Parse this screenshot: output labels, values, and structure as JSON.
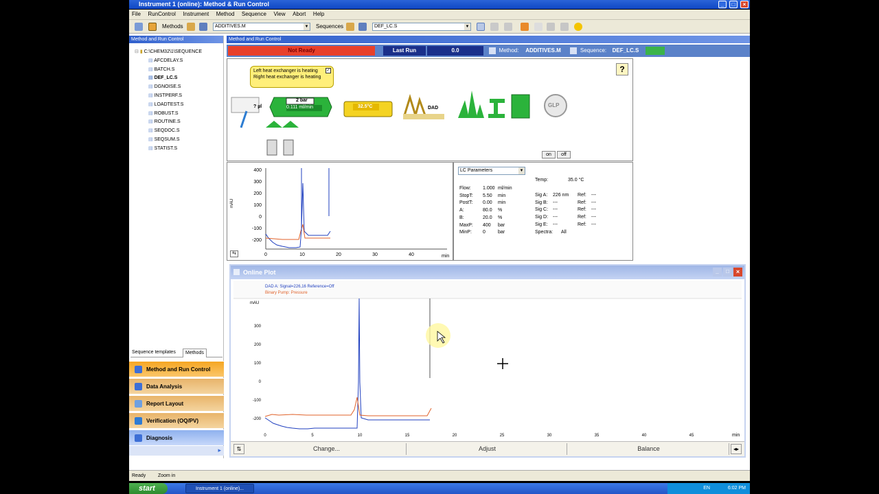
{
  "window": {
    "title": "Instrument 1 (online): Method & Run Control"
  },
  "menu": [
    "File",
    "RunControl",
    "Instrument",
    "Method",
    "Sequence",
    "View",
    "Abort",
    "Help"
  ],
  "toolbar": {
    "methods_label": "Methods",
    "method_value": "ADDITIVES.M",
    "sequences_label": "Sequences",
    "sequence_value": "DEF_LC.S"
  },
  "left_panel": {
    "title": "Method and Run Control",
    "root": "C:\\CHEM32\\1\\SEQUENCE",
    "files": [
      "AFCDELAY.S",
      "BATCH.S",
      "DEF_LC.S",
      "DGNOISE.S",
      "INSTPERF.S",
      "LOADTEST.S",
      "ROBUST.S",
      "ROUTINE.S",
      "SEQDOC.S",
      "SEQSUM.S",
      "STATIST.S"
    ],
    "tabs": [
      "Sequence templates",
      "Methods"
    ],
    "nav": [
      "Method and Run Control",
      "Data Analysis",
      "Report Layout",
      "Verification (OQ/PV)",
      "Diagnosis"
    ]
  },
  "main": {
    "title": "Method and Run Control",
    "status": "Not Ready",
    "last_run_label": "Last Run",
    "last_run_value": "0.0",
    "method_label": "Method:",
    "method_value": "ADDITIVES.M",
    "sequence_label": "Sequence:",
    "sequence_value": "DEF_LC.S"
  },
  "instrument": {
    "tooltip": "Left heat exchanger is heating Right heat exchanger is heating",
    "injector_volume": "? µl",
    "pump_pressure": "2 bar",
    "pump_flow": "0.111 ml/min",
    "column_temp": "32.5°C",
    "detector": "DAD",
    "glp": "GLP",
    "on": "on",
    "off": "off",
    "help": "?"
  },
  "mini_plot": {
    "yticks": [
      "400",
      "300",
      "200",
      "100",
      "0",
      "-100",
      "-200"
    ],
    "xticks": [
      "0",
      "10",
      "20",
      "30",
      "40"
    ],
    "xunit": "min",
    "yunit": "mAU"
  },
  "params": {
    "dropdown": "LC Parameters",
    "left": [
      {
        "k": "Flow:",
        "v": "1.000",
        "u": "ml/min"
      },
      {
        "k": "StopT:",
        "v": "5.50",
        "u": "min"
      },
      {
        "k": "PostT:",
        "v": "0.00",
        "u": "min"
      },
      {
        "k": "A:",
        "v": "80.0",
        "u": "%"
      },
      {
        "k": "B:",
        "v": "20.0",
        "u": "%"
      },
      {
        "k": "MaxP:",
        "v": "400",
        "u": "bar"
      },
      {
        "k": "MinP:",
        "v": "0",
        "u": "bar"
      }
    ],
    "temp_label": "Temp:",
    "temp_value": "35.0 °C",
    "signals": [
      {
        "k": "Sig A:",
        "v": "226 nm",
        "r": "Ref:",
        "rv": "---"
      },
      {
        "k": "Sig B:",
        "v": "---",
        "r": "Ref:",
        "rv": "---"
      },
      {
        "k": "Sig C:",
        "v": "---",
        "r": "Ref:",
        "rv": "---"
      },
      {
        "k": "Sig D:",
        "v": "---",
        "r": "Ref:",
        "rv": "---"
      },
      {
        "k": "Sig E:",
        "v": "---",
        "r": "Ref:",
        "rv": "---"
      }
    ],
    "spectra_label": "Spectra:",
    "spectra_value": "All"
  },
  "online_plot": {
    "title": "Online Plot",
    "legend1": "DAD A: Signal=226,16  Reference=Off",
    "legend2": "Binary Pump: Pressure",
    "yunit": "mAU",
    "yticks": [
      "300",
      "200",
      "100",
      "0",
      "-100",
      "-200"
    ],
    "xticks": [
      "0",
      "5",
      "10",
      "15",
      "20",
      "25",
      "30",
      "35",
      "40",
      "45"
    ],
    "xunit": "min",
    "buttons": [
      "Change...",
      "Adjust",
      "Balance"
    ]
  },
  "statusbar": {
    "left": "Ready",
    "right": "Zoom in"
  },
  "taskbar": {
    "start": "start",
    "item": "Instrument 1 (online)...",
    "lang": "EN",
    "time": "6:02 PM"
  },
  "colors": {
    "title_blue": "#0f47c4",
    "not_ready_red": "#e8402a",
    "pump_green": "#2bb33b",
    "nav_orange": "#f5a623",
    "signal_blue": "#1f3fbf",
    "pressure_orange": "#e0622a"
  }
}
